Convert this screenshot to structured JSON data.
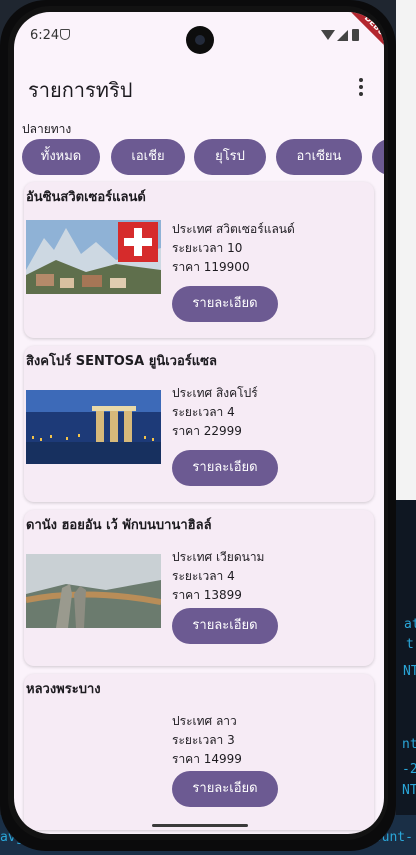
{
  "app": {
    "title": "รายการทริป",
    "time": "6:24",
    "debug_label": "DEBUG"
  },
  "filter": {
    "label": "ปลายทาง",
    "chips": [
      "ทั้งหมด",
      "เอเชีย",
      "ยุโรป",
      "อาเซียน"
    ]
  },
  "trips": [
    {
      "name": "อันซินสวิตเซอร์แลนด์",
      "country_line": "ประเทศ สวิตเซอร์แลนด์",
      "duration_line": "ระยะเวลา 10",
      "price_line": "ราคา 119900",
      "button": "รายละเอียด"
    },
    {
      "name": "สิงคโปร์ SENTOSA ยูนิเวอร์แซล",
      "country_line": "ประเทศ สิงคโปร์",
      "duration_line": "ระยะเวลา 4",
      "price_line": "ราคา 22999",
      "button": "รายละเอียด"
    },
    {
      "name": "ดานัง ฮอยอัน เว้ พักบนบานาฮิลล์",
      "country_line": "ประเทศ เวียดนาม",
      "duration_line": "ระยะเวลา 4",
      "price_line": "ราคา 13899",
      "button": "รายละเอียด"
    },
    {
      "name": "หลวงพระบาง",
      "country_line": "ประเทศ ลาว",
      "duration_line": "ระยะเวลา 3",
      "price_line": "ราคา 14999",
      "button": "รายละเอียด"
    }
  ],
  "colors": {
    "primary": "#6c5a92",
    "background": "#fbf3fb",
    "card": "#f6ebf5"
  },
  "ide_fragments": [
    "at",
    "t",
    "NT",
    "nt",
    "-2",
    "NT",
    "avg-",
    "count-"
  ]
}
